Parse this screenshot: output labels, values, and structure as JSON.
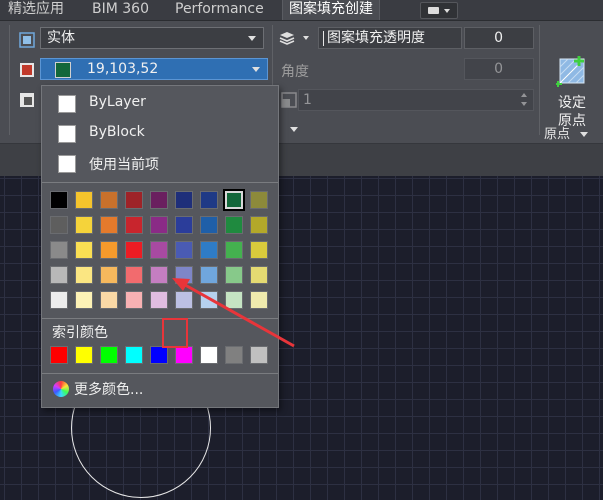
{
  "tabs": [
    {
      "label": "精选应用"
    },
    {
      "label": "BIM 360"
    },
    {
      "label": "Performance"
    },
    {
      "label": "图案填充创建",
      "active": true
    }
  ],
  "ribbon": {
    "hatch_type": "实体",
    "hatch_color_value": "19,103,52",
    "hatch_color_hex": "#13673a",
    "transparency_label": "图案填充透明度",
    "transparency_value": "0",
    "angle_label": "角度",
    "angle_value": "0",
    "scale_value": "1",
    "set_origin_label_line1": "设定",
    "set_origin_label_line2": "原点",
    "origin_panel_title": "原点"
  },
  "color_popup": {
    "options": [
      {
        "label": "ByLayer"
      },
      {
        "label": "ByBlock"
      },
      {
        "label": "使用当前项"
      }
    ],
    "index_title": "索引颜色",
    "more_colors_label": "更多颜色...",
    "palette": [
      [
        "#000000",
        "#f5c42c",
        "#c8712c",
        "#9e2328",
        "#6a1f5f",
        "#1f2f7a",
        "#1f3a86",
        "#13673a",
        "#8d8a3a"
      ],
      [
        "#5e5e5e",
        "#f5d33a",
        "#e47a2c",
        "#c8252d",
        "#8a2b86",
        "#2b3d9a",
        "#1f5fa8",
        "#1f8a3f",
        "#b3a82a"
      ],
      [
        "#8a8a8a",
        "#fadf53",
        "#f59a2c",
        "#ed1c24",
        "#a84aa1",
        "#4a5bb3",
        "#2f7cc6",
        "#44b14f",
        "#d9ca3c"
      ],
      [
        "#b8b8b8",
        "#fbe682",
        "#f6b85d",
        "#f26b6e",
        "#c47ec1",
        "#7e86c8",
        "#70a6dc",
        "#87c98a",
        "#e4da72"
      ],
      [
        "#ededed",
        "#fdf2b6",
        "#fad9a6",
        "#f8b1b3",
        "#e0bde0",
        "#bcc0e3",
        "#b6d1ee",
        "#c5e4c3",
        "#efeaad"
      ]
    ],
    "selected": {
      "row": 0,
      "col": 7
    },
    "index_colors": [
      "#ff0000",
      "#ffff00",
      "#00ff00",
      "#00ffff",
      "#0000ff",
      "#ff00ff",
      "#ffffff",
      "#808080",
      "#c0c0c0"
    ]
  },
  "icons": {
    "hatch_type": "hatch-boundary-icon",
    "hatch_color": "hatch-color-icon",
    "transparency": "layers-icon",
    "set_origin": "set-origin-icon",
    "panel_expand": "expand-arrow-icon"
  }
}
